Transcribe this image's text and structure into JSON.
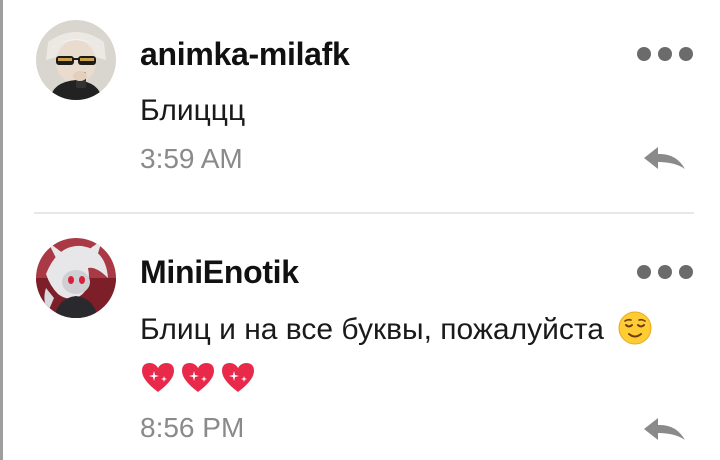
{
  "comments": [
    {
      "username": "animka-milafk",
      "message": "Блиццц",
      "time": "3:59 AM",
      "avatar_icon": "user-avatar-icon"
    },
    {
      "username": "MiniEnotik",
      "message": "Блиц и на все буквы, пожалуйста",
      "message_emoji": "relieved-face-emoji",
      "emoji_line": [
        "sparkling-heart-emoji",
        "sparkling-heart-emoji",
        "sparkling-heart-emoji"
      ],
      "time": "8:56 PM",
      "avatar_icon": "user-avatar-icon"
    }
  ],
  "icons": {
    "more": "more-dots-icon",
    "reply": "reply-arrow-icon"
  },
  "colors": {
    "username": "#111111",
    "message": "#1a1a1a",
    "timestamp": "#8a8a8a",
    "icon_gray": "#6b6b6b",
    "heart": "#e8294a"
  }
}
